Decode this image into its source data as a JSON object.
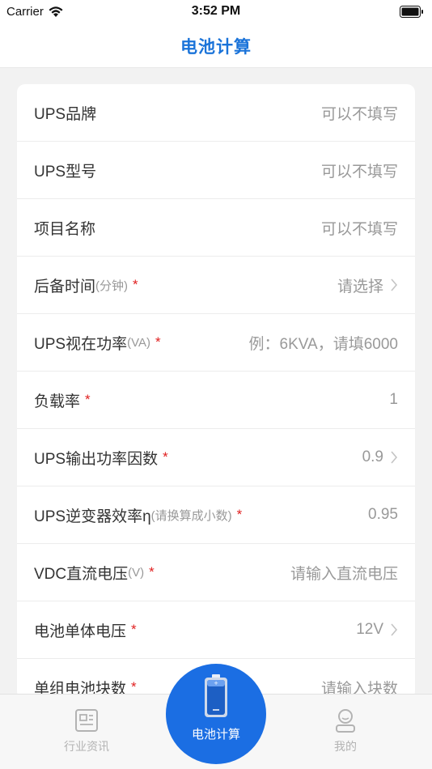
{
  "status_bar": {
    "carrier": "Carrier",
    "time": "3:52 PM"
  },
  "nav": {
    "title": "电池计算"
  },
  "form": {
    "rows": [
      {
        "label": "UPS品牌",
        "unit": "",
        "required": "",
        "value": "可以不填写",
        "chevron": false
      },
      {
        "label": "UPS型号",
        "unit": "",
        "required": "",
        "value": "可以不填写",
        "chevron": false
      },
      {
        "label": "项目名称",
        "unit": "",
        "required": "",
        "value": "可以不填写",
        "chevron": false
      },
      {
        "label": "后备时间",
        "unit": "(分钟)",
        "required": "*",
        "value": "请选择",
        "chevron": true
      },
      {
        "label": "UPS视在功率",
        "unit": "(VA)",
        "required": "*",
        "value": "例：6KVA，请填6000",
        "chevron": false
      },
      {
        "label": "负载率",
        "unit": "",
        "required": "*",
        "value": "1",
        "chevron": false
      },
      {
        "label": "UPS输出功率因数",
        "unit": "",
        "required": "*",
        "value": "0.9",
        "chevron": true
      },
      {
        "label": "UPS逆变器效率η",
        "unit": "(请换算成小数)",
        "required": "*",
        "value": "0.95",
        "chevron": false
      },
      {
        "label": "VDC直流电压",
        "unit": "(V)",
        "required": "*",
        "value": "请输入直流电压",
        "chevron": false
      },
      {
        "label": "电池单体电压",
        "unit": "",
        "required": "*",
        "value": "12V",
        "chevron": true
      },
      {
        "label": "单组电池块数",
        "unit": "",
        "required": "*",
        "value": "请输入块数",
        "chevron": false
      }
    ]
  },
  "tabbar": {
    "left": {
      "label": "行业资讯",
      "icon": "news-icon"
    },
    "center": {
      "label": "电池计算",
      "icon": "battery-icon"
    },
    "right": {
      "label": "我的",
      "icon": "profile-icon"
    }
  },
  "colors": {
    "accent": "#1b6ee3",
    "title": "#1a73d9",
    "required": "#e02020"
  }
}
